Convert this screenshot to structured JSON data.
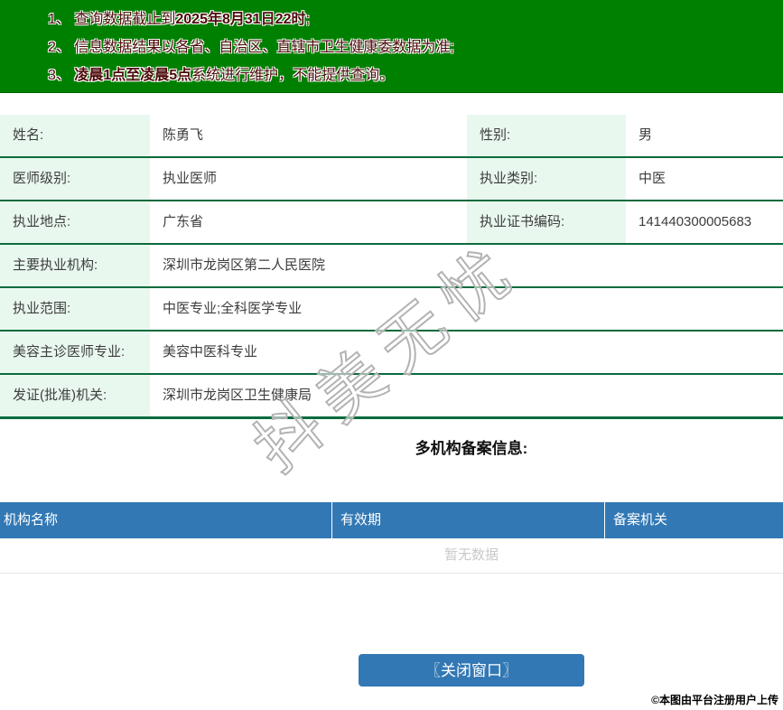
{
  "notice": {
    "lines": [
      {
        "num": "1、",
        "pre": "查询数据截止到",
        "bold": "2025年8月31日22时",
        "post": ";"
      },
      {
        "num": "2、",
        "pre": "信息数据结果以各省、自治区、直辖市卫生健康委数据为准;",
        "bold": "",
        "post": ""
      },
      {
        "num": "3、",
        "pre": "",
        "bold": "凌晨1点至凌晨5点",
        "post": "系统进行维护，不能提供查询。"
      }
    ]
  },
  "profile": {
    "rows": [
      {
        "label1": "姓名:",
        "value1": "陈勇飞",
        "label2": "性别:",
        "value2": "男"
      },
      {
        "label1": "医师级别:",
        "value1": "执业医师",
        "label2": "执业类别:",
        "value2": "中医"
      },
      {
        "label1": "执业地点:",
        "value1": "广东省",
        "label2": "执业证书编码:",
        "value2": "141440300005683"
      },
      {
        "label1": "主要执业机构:",
        "value1": "深圳市龙岗区第二人民医院"
      },
      {
        "label1": "执业范围:",
        "value1": "中医专业;全科医学专业"
      },
      {
        "label1": "美容主诊医师专业:",
        "value1": "美容中医科专业"
      },
      {
        "label1": "发证(批准)机关:",
        "value1": "深圳市龙岗区卫生健康局"
      }
    ]
  },
  "multi_org": {
    "title": "多机构备案信息:",
    "columns": [
      "机构名称",
      "有效期",
      "备案机关"
    ],
    "empty_text": "暂无数据"
  },
  "footer": {
    "close_button": "〖关闭窗口〗",
    "copyright": "©本图由平台注册用户上传"
  },
  "watermark": {
    "text": "抖美无忧"
  },
  "colors": {
    "banner_green": "#008000",
    "notice_text": "#4d0a0a",
    "label_bg": "#e9f8ef",
    "row_border": "#0b6b3d",
    "header_blue": "#3278b4",
    "empty_text_gray": "#c9c9c9"
  }
}
